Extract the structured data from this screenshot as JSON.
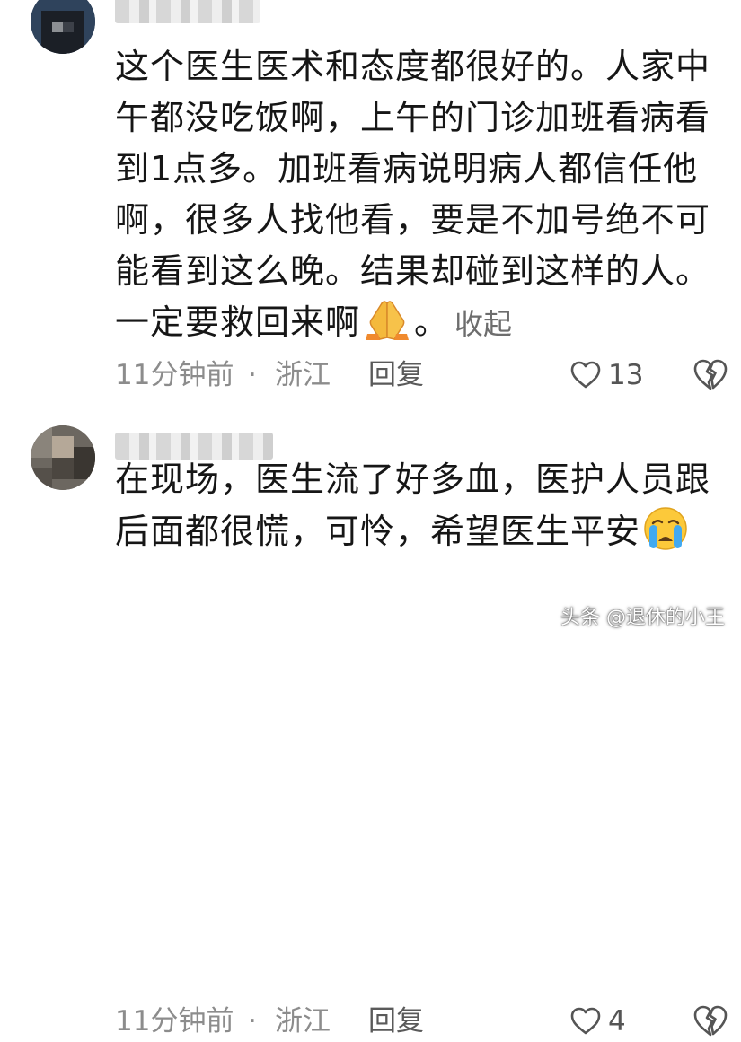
{
  "comments": [
    {
      "username": "",
      "lines": [
        "这个医生医术和态度都很好的。人家中",
        "午都没吃饭啊，上午的门诊加班看病看",
        "到1点多。加班看病说明病人都信任他",
        "啊，很多人找他看，要是不加号绝不可",
        "能看到这么晚。结果却碰到这样的人。",
        "一定要救回来啊"
      ],
      "after_emoji": "。",
      "collapse_label": "收起",
      "time": "11分钟前",
      "separator": "·",
      "location": "浙江",
      "reply_label": "回复",
      "like_count": "13"
    },
    {
      "username": "",
      "lines": [
        "在现场，医生流了好多血，医护人员跟",
        "后面都很慌，可怜，希望医生平安"
      ],
      "time": "11分钟前",
      "separator": "·",
      "location": "浙江",
      "reply_label": "回复",
      "like_count": "4"
    }
  ],
  "icons": {
    "pray_emoji": "folded-hands-emoji",
    "cry_emoji": "crying-face-emoji",
    "like": "heart-outline-icon",
    "dislike": "broken-heart-icon"
  },
  "watermark": "头条 @退休的小王"
}
